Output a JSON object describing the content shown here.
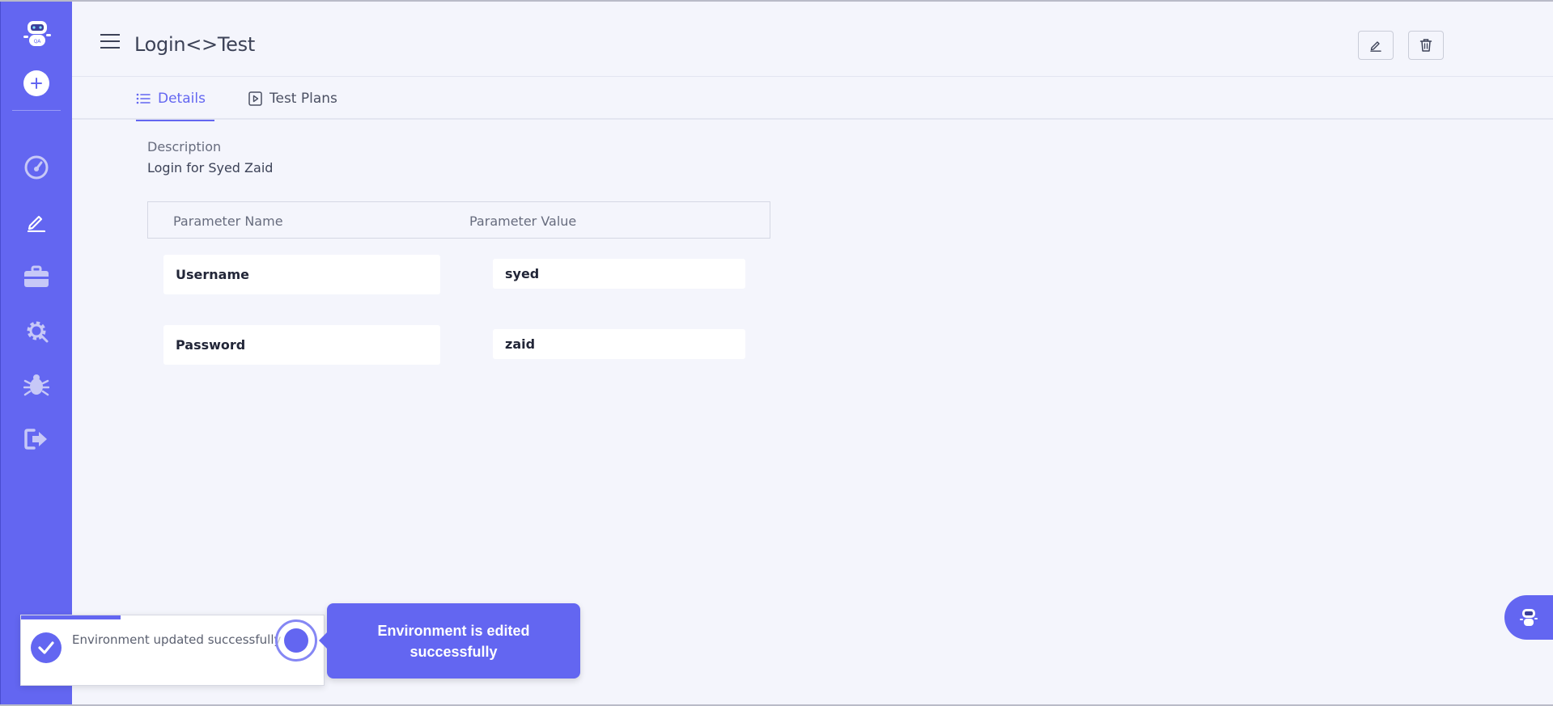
{
  "header": {
    "title": "Login<>Test"
  },
  "tabs": [
    {
      "label": "Details",
      "active": true
    },
    {
      "label": "Test Plans",
      "active": false
    }
  ],
  "details": {
    "description_label": "Description",
    "description_value": "Login for Syed Zaid"
  },
  "parameters": {
    "headers": [
      "Parameter Name",
      "Parameter Value"
    ],
    "rows": [
      {
        "name": "Username",
        "value": "syed"
      },
      {
        "name": "Password",
        "value": "zaid"
      }
    ]
  },
  "toast": {
    "message": "Environment updated successfully",
    "progress_fraction": 0.33
  },
  "guide": {
    "tooltip": "Environment is edited successfully"
  },
  "sidebar": {
    "icons": [
      "robot-logo-icon",
      "add-icon",
      "dashboard-icon",
      "pencil-icon",
      "briefcase-icon",
      "gear-icon",
      "bug-icon",
      "logout-icon"
    ]
  },
  "colors": {
    "accent": "#6366f1",
    "background": "#f4f5fc"
  }
}
